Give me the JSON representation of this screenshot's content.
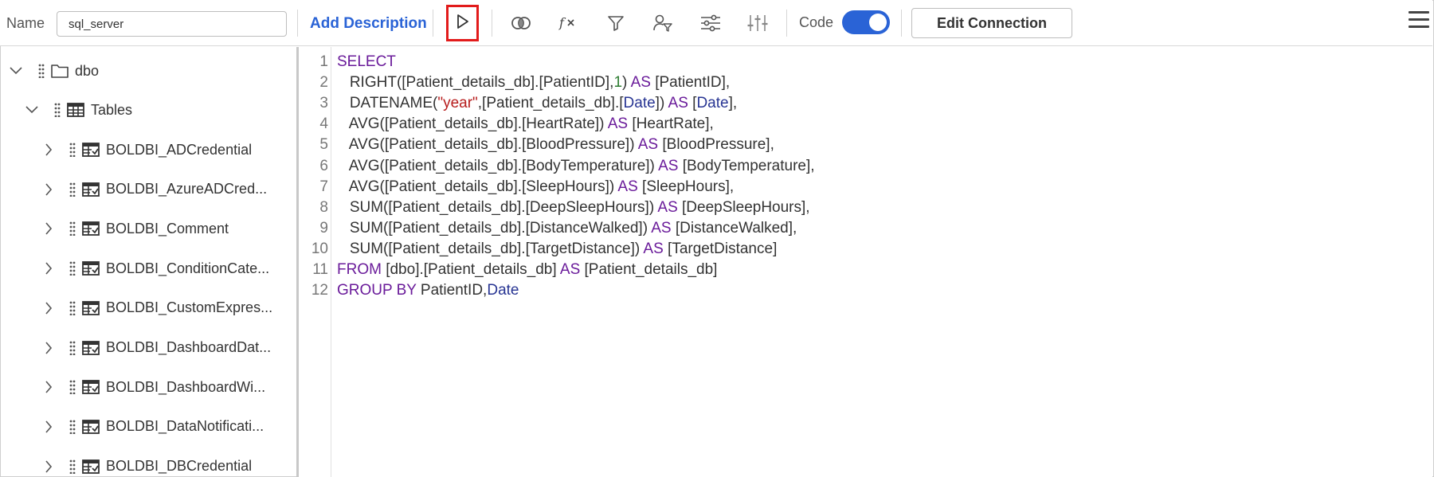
{
  "toolbar": {
    "name_label": "Name",
    "name_value": "sql_server",
    "add_description": "Add Description",
    "icons": [
      "play-icon",
      "join-icon",
      "function-icon",
      "filter-icon",
      "user-filter-icon",
      "settings-sliders-icon",
      "column-sliders-icon"
    ],
    "code_label": "Code",
    "code_enabled": true,
    "edit_connection": "Edit Connection",
    "accent_color": "#2a63d6",
    "highlight_color": "#e21b1b"
  },
  "tree": {
    "schema": "dbo",
    "tables_label": "Tables",
    "tables": [
      "BOLDBI_ADCredential",
      "BOLDBI_AzureADCred...",
      "BOLDBI_Comment",
      "BOLDBI_ConditionCate...",
      "BOLDBI_CustomExpres...",
      "BOLDBI_DashboardDat...",
      "BOLDBI_DashboardWi...",
      "BOLDBI_DataNotificati...",
      "BOLDBI_DBCredential"
    ]
  },
  "editor": {
    "line_numbers": [
      "1",
      "2",
      "3",
      "4",
      "5",
      "6",
      "7",
      "8",
      "9",
      "10",
      "11",
      "12"
    ],
    "lines": [
      [
        {
          "t": "SELECT",
          "c": "kw"
        }
      ],
      [
        {
          "t": "   RIGHT([Patient_details_db].[PatientID],"
        },
        {
          "t": "1",
          "c": "num"
        },
        {
          "t": ") "
        },
        {
          "t": "AS",
          "c": "kw"
        },
        {
          "t": " [PatientID],"
        }
      ],
      [
        {
          "t": "   DATENAME("
        },
        {
          "t": "\"year\"",
          "c": "str"
        },
        {
          "t": ",[Patient_details_db].["
        },
        {
          "t": "Date",
          "c": "fn"
        },
        {
          "t": "]) "
        },
        {
          "t": "AS",
          "c": "kw"
        },
        {
          "t": " ["
        },
        {
          "t": "Date",
          "c": "fn"
        },
        {
          "t": "],"
        }
      ],
      [
        {
          "t": "   AVG([Patient_details_db].[HeartRate]) "
        },
        {
          "t": "AS",
          "c": "kw"
        },
        {
          "t": " [HeartRate],"
        }
      ],
      [
        {
          "t": "   AVG([Patient_details_db].[BloodPressure]) "
        },
        {
          "t": "AS",
          "c": "kw"
        },
        {
          "t": " [BloodPressure],"
        }
      ],
      [
        {
          "t": "   AVG([Patient_details_db].[BodyTemperature]) "
        },
        {
          "t": "AS",
          "c": "kw"
        },
        {
          "t": " [BodyTemperature],"
        }
      ],
      [
        {
          "t": "   AVG([Patient_details_db].[SleepHours]) "
        },
        {
          "t": "AS",
          "c": "kw"
        },
        {
          "t": " [SleepHours],"
        }
      ],
      [
        {
          "t": "   SUM([Patient_details_db].[DeepSleepHours]) "
        },
        {
          "t": "AS",
          "c": "kw"
        },
        {
          "t": " [DeepSleepHours],"
        }
      ],
      [
        {
          "t": "   SUM([Patient_details_db].[DistanceWalked]) "
        },
        {
          "t": "AS",
          "c": "kw"
        },
        {
          "t": " [DistanceWalked],"
        }
      ],
      [
        {
          "t": "   SUM([Patient_details_db].[TargetDistance]) "
        },
        {
          "t": "AS",
          "c": "kw"
        },
        {
          "t": " [TargetDistance]"
        }
      ],
      [
        {
          "t": "FROM",
          "c": "kw"
        },
        {
          "t": " [dbo].[Patient_details_db] "
        },
        {
          "t": "AS",
          "c": "kw"
        },
        {
          "t": " [Patient_details_db]"
        }
      ],
      [
        {
          "t": "GROUP BY",
          "c": "kw"
        },
        {
          "t": " PatientID,"
        },
        {
          "t": "Date",
          "c": "fn"
        }
      ]
    ]
  }
}
